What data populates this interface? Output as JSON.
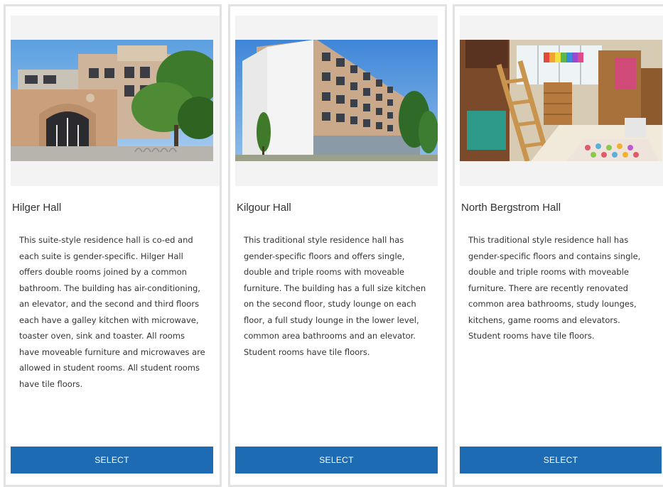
{
  "cards": [
    {
      "title": "Hilger Hall",
      "description": "This suite-style residence hall is co-ed and each suite is gender-specific. Hilger Hall offers double rooms joined by a common bathroom. The building has air-conditioning, an elevator, and the second and third floors each have a galley kitchen with microwave, toaster oven, sink and toaster. All rooms have moveable furniture and microwaves are allowed in student rooms. All student rooms have tile floors.",
      "button_label": "SELECT"
    },
    {
      "title": "Kilgour Hall",
      "description": "This traditional style residence hall has gender-specific floors and offers single, double and triple rooms with moveable furniture. The building has a full size kitchen on the second floor, study lounge on each floor, a full study lounge in the lower level, common area bathrooms and an elevator. Student rooms have tile floors.",
      "button_label": "SELECT"
    },
    {
      "title": "North Bergstrom Hall",
      "description": "This traditional style residence hall has gender-specific floors and contains single, double and triple rooms with moveable furniture. There are recently renovated common area bathrooms, study lounges, kitchens, game rooms and elevators. Student rooms have tile floors.",
      "button_label": "SELECT"
    }
  ],
  "colors": {
    "button": "#1c6bb3",
    "card_border": "#e2e2e2",
    "image_panel": "#f3f3f3"
  }
}
